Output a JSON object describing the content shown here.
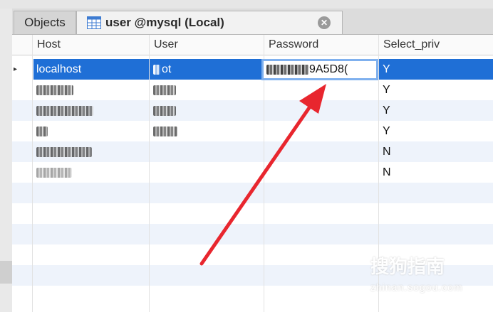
{
  "tabs": {
    "objects_label": "Objects",
    "user_tab_label": "user @mysql (Local)"
  },
  "table": {
    "columns": [
      "Host",
      "User",
      "Password",
      "Select_priv"
    ],
    "rows": [
      {
        "host": "localhost",
        "user": "root",
        "password": "9A5D8(",
        "select_priv": "Y"
      },
      {
        "host": "",
        "user": "",
        "password": "",
        "select_priv": "Y"
      },
      {
        "host": "",
        "user": "",
        "password": "",
        "select_priv": "Y"
      },
      {
        "host": "",
        "user": "",
        "password": "",
        "select_priv": "Y"
      },
      {
        "host": "",
        "user": "",
        "password": "",
        "select_priv": "N"
      },
      {
        "host": "",
        "user": "",
        "password": "",
        "select_priv": "N"
      }
    ]
  },
  "annotation": {
    "arrow_color": "#e8262e"
  },
  "watermark": {
    "logo": "搜狗指南",
    "url": "zhinan.sogou.com"
  },
  "colors": {
    "selection": "#1f6fd6",
    "editor_border": "#7fb0ee"
  }
}
